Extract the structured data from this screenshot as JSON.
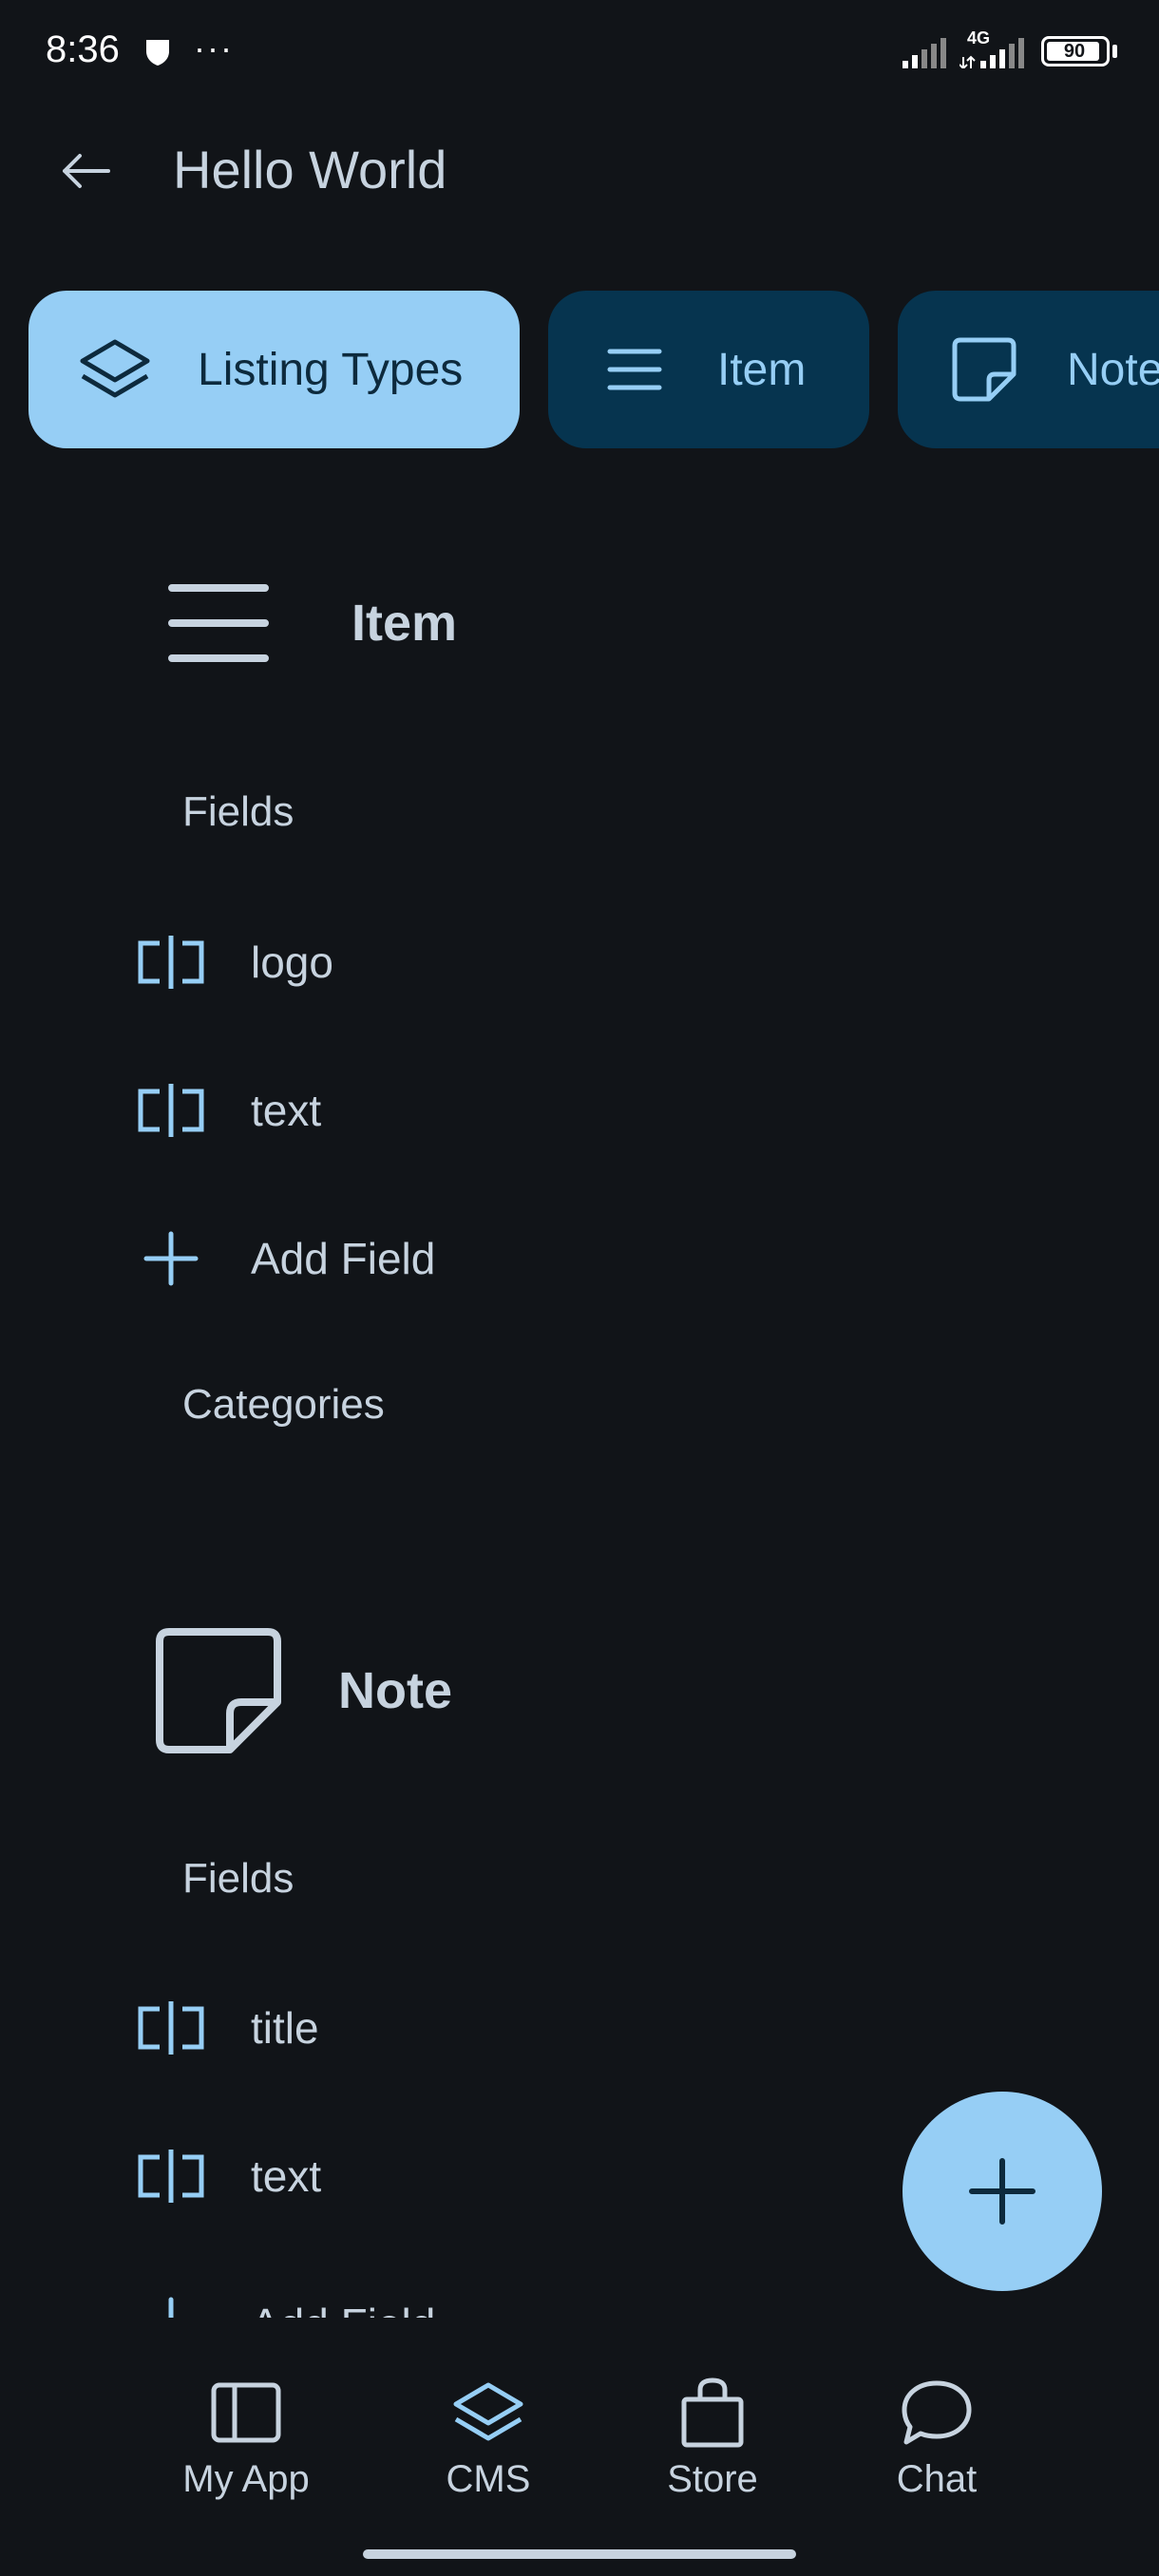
{
  "status_bar": {
    "time": "8:36",
    "dots": "···",
    "network": "4G",
    "battery": "90",
    "icons": [
      "shield-icon",
      "cellular-signal-icon",
      "battery-icon"
    ]
  },
  "app_bar": {
    "back_icon": "arrow-left-icon",
    "title": "Hello World"
  },
  "chips": [
    {
      "label": "Listing Types",
      "icon": "layers-icon",
      "selected": true
    },
    {
      "label": "Item",
      "icon": "menu-lines-icon",
      "selected": false
    },
    {
      "label": "Note",
      "icon": "sticky-note-icon",
      "selected": false
    }
  ],
  "sections": [
    {
      "title": "Item",
      "icon": "menu-lines-icon",
      "fields_heading": "Fields",
      "fields": [
        "logo",
        "text"
      ],
      "add_field_label": "Add Field",
      "categories_heading": "Categories"
    },
    {
      "title": "Note",
      "icon": "sticky-note-icon",
      "fields_heading": "Fields",
      "fields": [
        "title",
        "text"
      ],
      "add_field_label": "Add Field"
    }
  ],
  "fab": {
    "icon": "plus-icon"
  },
  "bottom_nav": [
    {
      "label": "My App",
      "icon": "sidebar-panel-icon"
    },
    {
      "label": "CMS",
      "icon": "layers-icon",
      "selected": true
    },
    {
      "label": "Store",
      "icon": "shopping-bag-icon"
    },
    {
      "label": "Chat",
      "icon": "chat-bubble-icon"
    }
  ],
  "colors": {
    "background": "#111418",
    "accent": "#96cef5",
    "chip_inactive": "#06344f",
    "text": "#c7d3df"
  }
}
